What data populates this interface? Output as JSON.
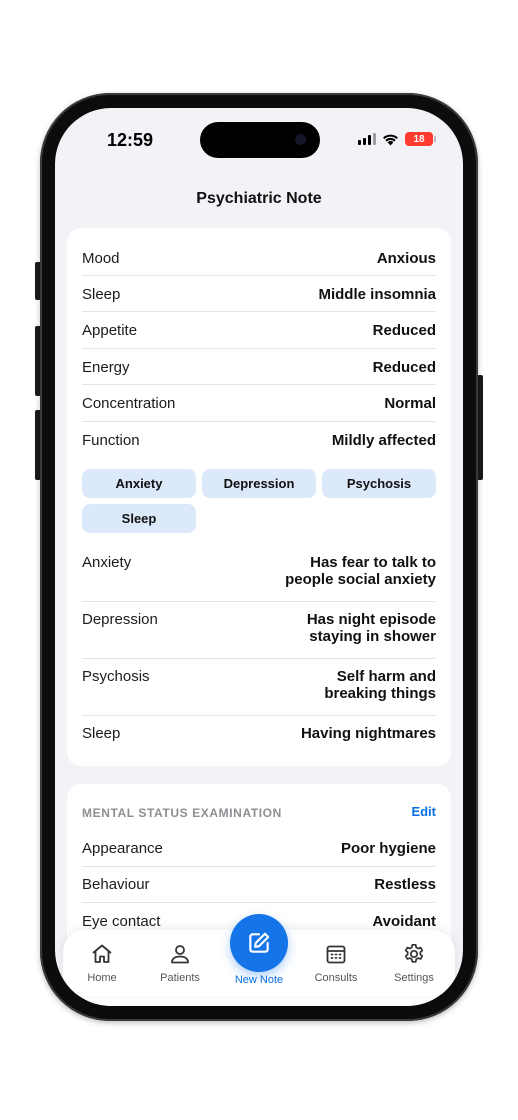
{
  "status_bar": {
    "time": "12:59",
    "battery": "18"
  },
  "header": {
    "title": "Psychiatric Note"
  },
  "history": [
    {
      "label": "Mood",
      "value": "Anxious"
    },
    {
      "label": "Sleep",
      "value": "Middle insomnia"
    },
    {
      "label": "Appetite",
      "value": "Reduced"
    },
    {
      "label": "Energy",
      "value": "Reduced"
    },
    {
      "label": "Concentration",
      "value": "Normal"
    },
    {
      "label": "Function",
      "value": "Mildly affected"
    }
  ],
  "chips": [
    "Anxiety",
    "Depression",
    "Psychosis",
    "Sleep"
  ],
  "symptoms": [
    {
      "label": "Anxiety",
      "value_line1": "Has fear to talk to",
      "value_line2": "people social anxiety"
    },
    {
      "label": "Depression",
      "value_line1": "Has night episode",
      "value_line2": "staying in shower"
    },
    {
      "label": "Psychosis",
      "value_line1": "Self harm and",
      "value_line2": "breaking things"
    },
    {
      "label": "Sleep",
      "value_line1": "Having nightmares",
      "value_line2": ""
    }
  ],
  "mse": {
    "header": "MENTAL STATUS EXAMINATION",
    "edit": "Edit",
    "rows": [
      {
        "label": "Appearance",
        "value": "Poor hygiene"
      },
      {
        "label": "Behaviour",
        "value": "Restless"
      },
      {
        "label": "Eye contact",
        "value": "Avoidant"
      }
    ]
  },
  "tabbar": {
    "home": "Home",
    "patients": "Patients",
    "new_note": "New Note",
    "consults": "Consults",
    "settings": "Settings"
  },
  "colors": {
    "accent": "#1474e8",
    "chip_bg": "#dbe9fb",
    "background": "#f2f2f7"
  }
}
